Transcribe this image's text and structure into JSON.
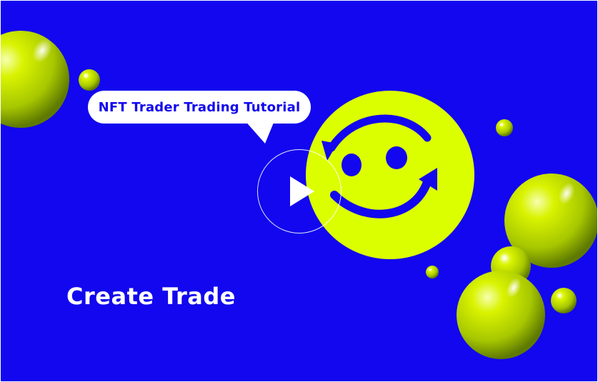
{
  "video": {
    "bubble_text": "NFT Trader Trading Tutorial",
    "headline": "Create Trade"
  },
  "icons": {
    "play": "play-icon",
    "smiley": "smiley-logo-icon",
    "spheres": "decorative-sphere"
  },
  "colors": {
    "background": "#1207ee",
    "accent": "#dcff00",
    "text_light": "#ffffff"
  }
}
